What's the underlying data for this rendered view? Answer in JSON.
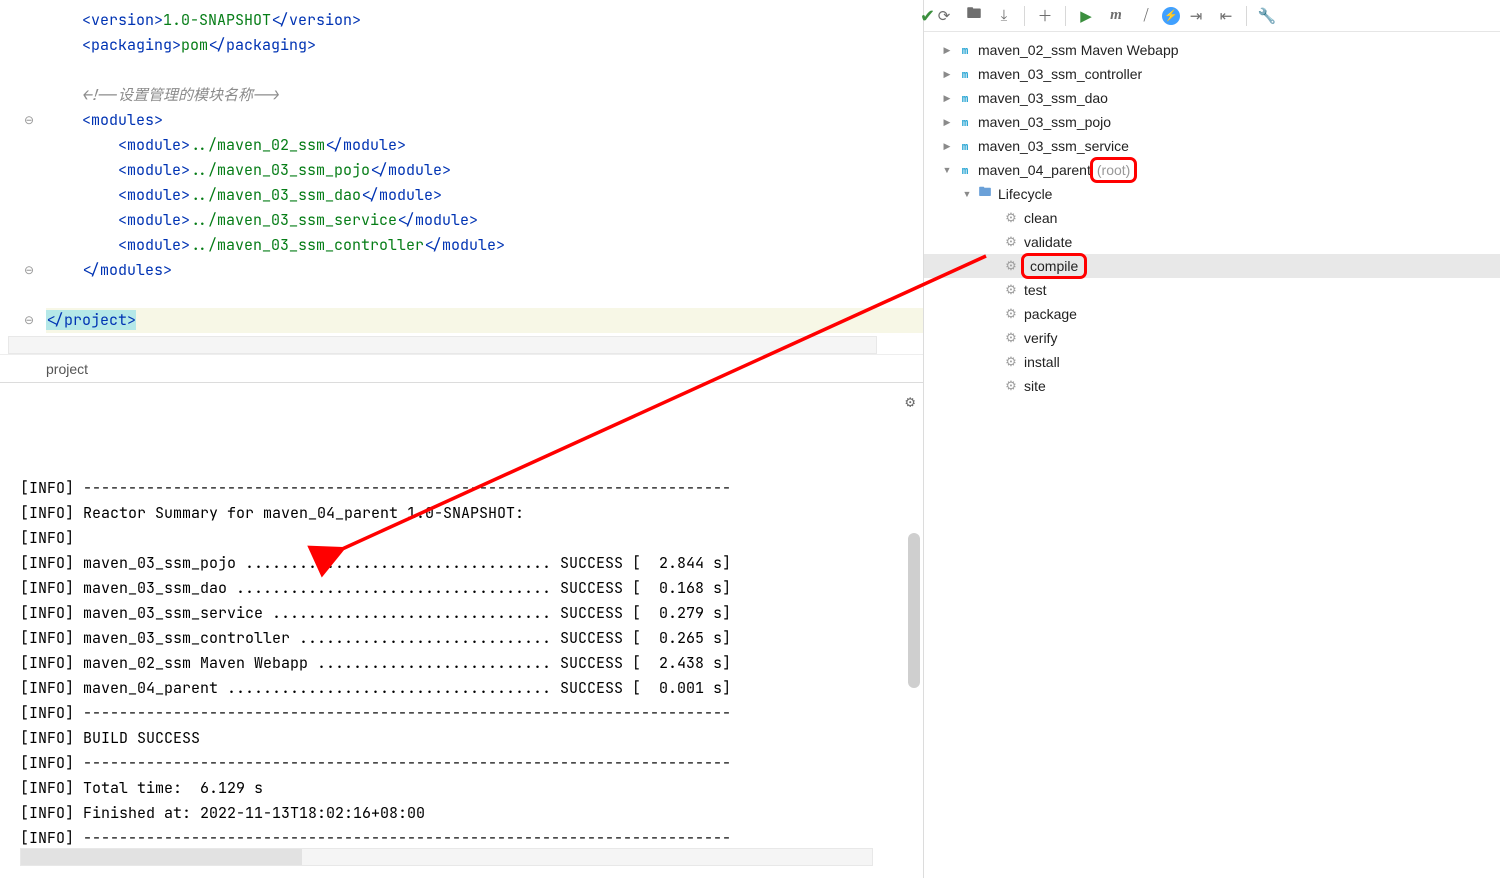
{
  "editor": {
    "code_lines": [
      {
        "indent": 1,
        "type": "row",
        "parts": [
          {
            "kind": "open",
            "tag": "version"
          },
          {
            "kind": "text",
            "v": "1.0-SNAPSHOT"
          },
          {
            "kind": "close",
            "tag": "version"
          }
        ]
      },
      {
        "indent": 1,
        "type": "row",
        "parts": [
          {
            "kind": "open",
            "tag": "packaging"
          },
          {
            "kind": "text",
            "v": "pom"
          },
          {
            "kind": "close",
            "tag": "packaging"
          }
        ]
      },
      {
        "indent": 1,
        "type": "blank"
      },
      {
        "indent": 1,
        "type": "comment",
        "text": "<!--设置管理的模块名称-->"
      },
      {
        "indent": 1,
        "type": "open",
        "tag": "modules"
      },
      {
        "indent": 2,
        "type": "row",
        "parts": [
          {
            "kind": "open",
            "tag": "module"
          },
          {
            "kind": "text",
            "v": "../maven_02_ssm"
          },
          {
            "kind": "close",
            "tag": "module"
          }
        ]
      },
      {
        "indent": 2,
        "type": "row",
        "parts": [
          {
            "kind": "open",
            "tag": "module"
          },
          {
            "kind": "text",
            "v": "../maven_03_ssm_pojo"
          },
          {
            "kind": "close",
            "tag": "module"
          }
        ]
      },
      {
        "indent": 2,
        "type": "row",
        "parts": [
          {
            "kind": "open",
            "tag": "module"
          },
          {
            "kind": "text",
            "v": "../maven_03_ssm_dao"
          },
          {
            "kind": "close",
            "tag": "module"
          }
        ]
      },
      {
        "indent": 2,
        "type": "row",
        "parts": [
          {
            "kind": "open",
            "tag": "module"
          },
          {
            "kind": "text",
            "v": "../maven_03_ssm_service"
          },
          {
            "kind": "close",
            "tag": "module"
          }
        ]
      },
      {
        "indent": 2,
        "type": "row",
        "parts": [
          {
            "kind": "open",
            "tag": "module"
          },
          {
            "kind": "text",
            "v": "../maven_03_ssm_controller"
          },
          {
            "kind": "close",
            "tag": "module"
          }
        ]
      },
      {
        "indent": 1,
        "type": "close",
        "tag": "modules"
      },
      {
        "indent": 0,
        "type": "blank"
      },
      {
        "indent": 0,
        "type": "close-highlight",
        "tag": "project"
      }
    ],
    "breadcrumb": "project"
  },
  "console_lines": [
    "[INFO] ------------------------------------------------------------------------",
    "[INFO] Reactor Summary for maven_04_parent 1.0-SNAPSHOT:",
    "[INFO]",
    "[INFO] maven_03_ssm_pojo .................................. SUCCESS [  2.844 s]",
    "[INFO] maven_03_ssm_dao ................................... SUCCESS [  0.168 s]",
    "[INFO] maven_03_ssm_service ............................... SUCCESS [  0.279 s]",
    "[INFO] maven_03_ssm_controller ............................ SUCCESS [  0.265 s]",
    "[INFO] maven_02_ssm Maven Webapp .......................... SUCCESS [  2.438 s]",
    "[INFO] maven_04_parent .................................... SUCCESS [  0.001 s]",
    "[INFO] ------------------------------------------------------------------------",
    "[INFO] BUILD SUCCESS",
    "[INFO] ------------------------------------------------------------------------",
    "[INFO] Total time:  6.129 s",
    "[INFO] Finished at: 2022-11-13T18:02:16+08:00",
    "[INFO] ------------------------------------------------------------------------"
  ],
  "maven_tree": {
    "modules": [
      {
        "name": "maven_02_ssm Maven Webapp",
        "expanded": false
      },
      {
        "name": "maven_03_ssm_controller",
        "expanded": false
      },
      {
        "name": "maven_03_ssm_dao",
        "expanded": false
      },
      {
        "name": "maven_03_ssm_pojo",
        "expanded": false
      },
      {
        "name": "maven_03_ssm_service",
        "expanded": false
      },
      {
        "name": "maven_04_parent",
        "suffix": "(root)",
        "expanded": true,
        "highlight_suffix": true
      }
    ],
    "lifecycle_label": "Lifecycle",
    "lifecycle": [
      {
        "name": "clean"
      },
      {
        "name": "validate"
      },
      {
        "name": "compile",
        "selected": true,
        "highlight_label": true
      },
      {
        "name": "test"
      },
      {
        "name": "package"
      },
      {
        "name": "verify"
      },
      {
        "name": "install"
      },
      {
        "name": "site"
      }
    ]
  },
  "toolbar_icons": [
    "refresh",
    "folder-gear",
    "download",
    "sep",
    "plus",
    "sep",
    "run",
    "m",
    "skip",
    "blue-bolt",
    "collapse",
    "expand",
    "sep",
    "wrench"
  ]
}
